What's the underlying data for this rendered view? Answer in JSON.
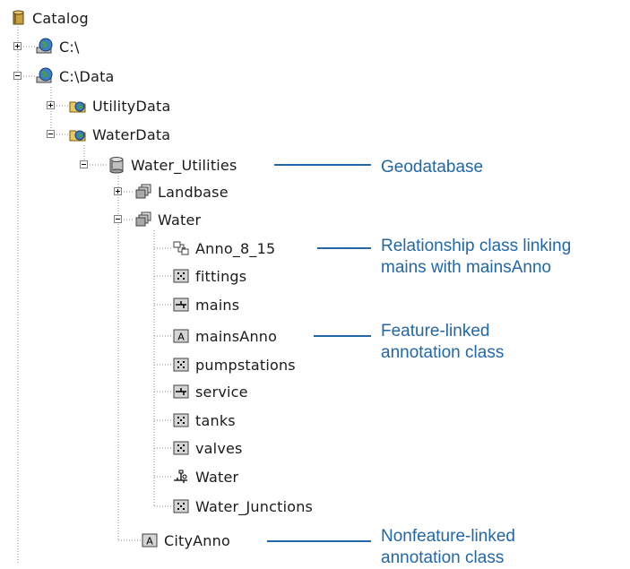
{
  "tree": {
    "root": "Catalog",
    "drive_c": "C:\\",
    "c_data": "C:\\Data",
    "utility_data": "UtilityData",
    "water_data": "WaterData",
    "water_utilities": "Water_Utilities",
    "landbase": "Landbase",
    "water_dataset": "Water",
    "classes": [
      "Anno_8_15",
      "fittings",
      "mains",
      "mainsAnno",
      "pumpstations",
      "service",
      "tanks",
      "valves",
      "Water",
      "Water_Junctions"
    ],
    "city_anno": "CityAnno"
  },
  "callouts": {
    "geodatabase": "Geodatabase",
    "relationship_line1": "Relationship class linking",
    "relationship_line2": "mains with mainsAnno",
    "feature_linked_line1": "Feature-linked",
    "feature_linked_line2": "annotation class",
    "nonfeature_linked_line1": "Nonfeature-linked",
    "nonfeature_linked_line2": "annotation class"
  },
  "colors": {
    "callout": "#2267a8",
    "tree_line": "#808080"
  }
}
